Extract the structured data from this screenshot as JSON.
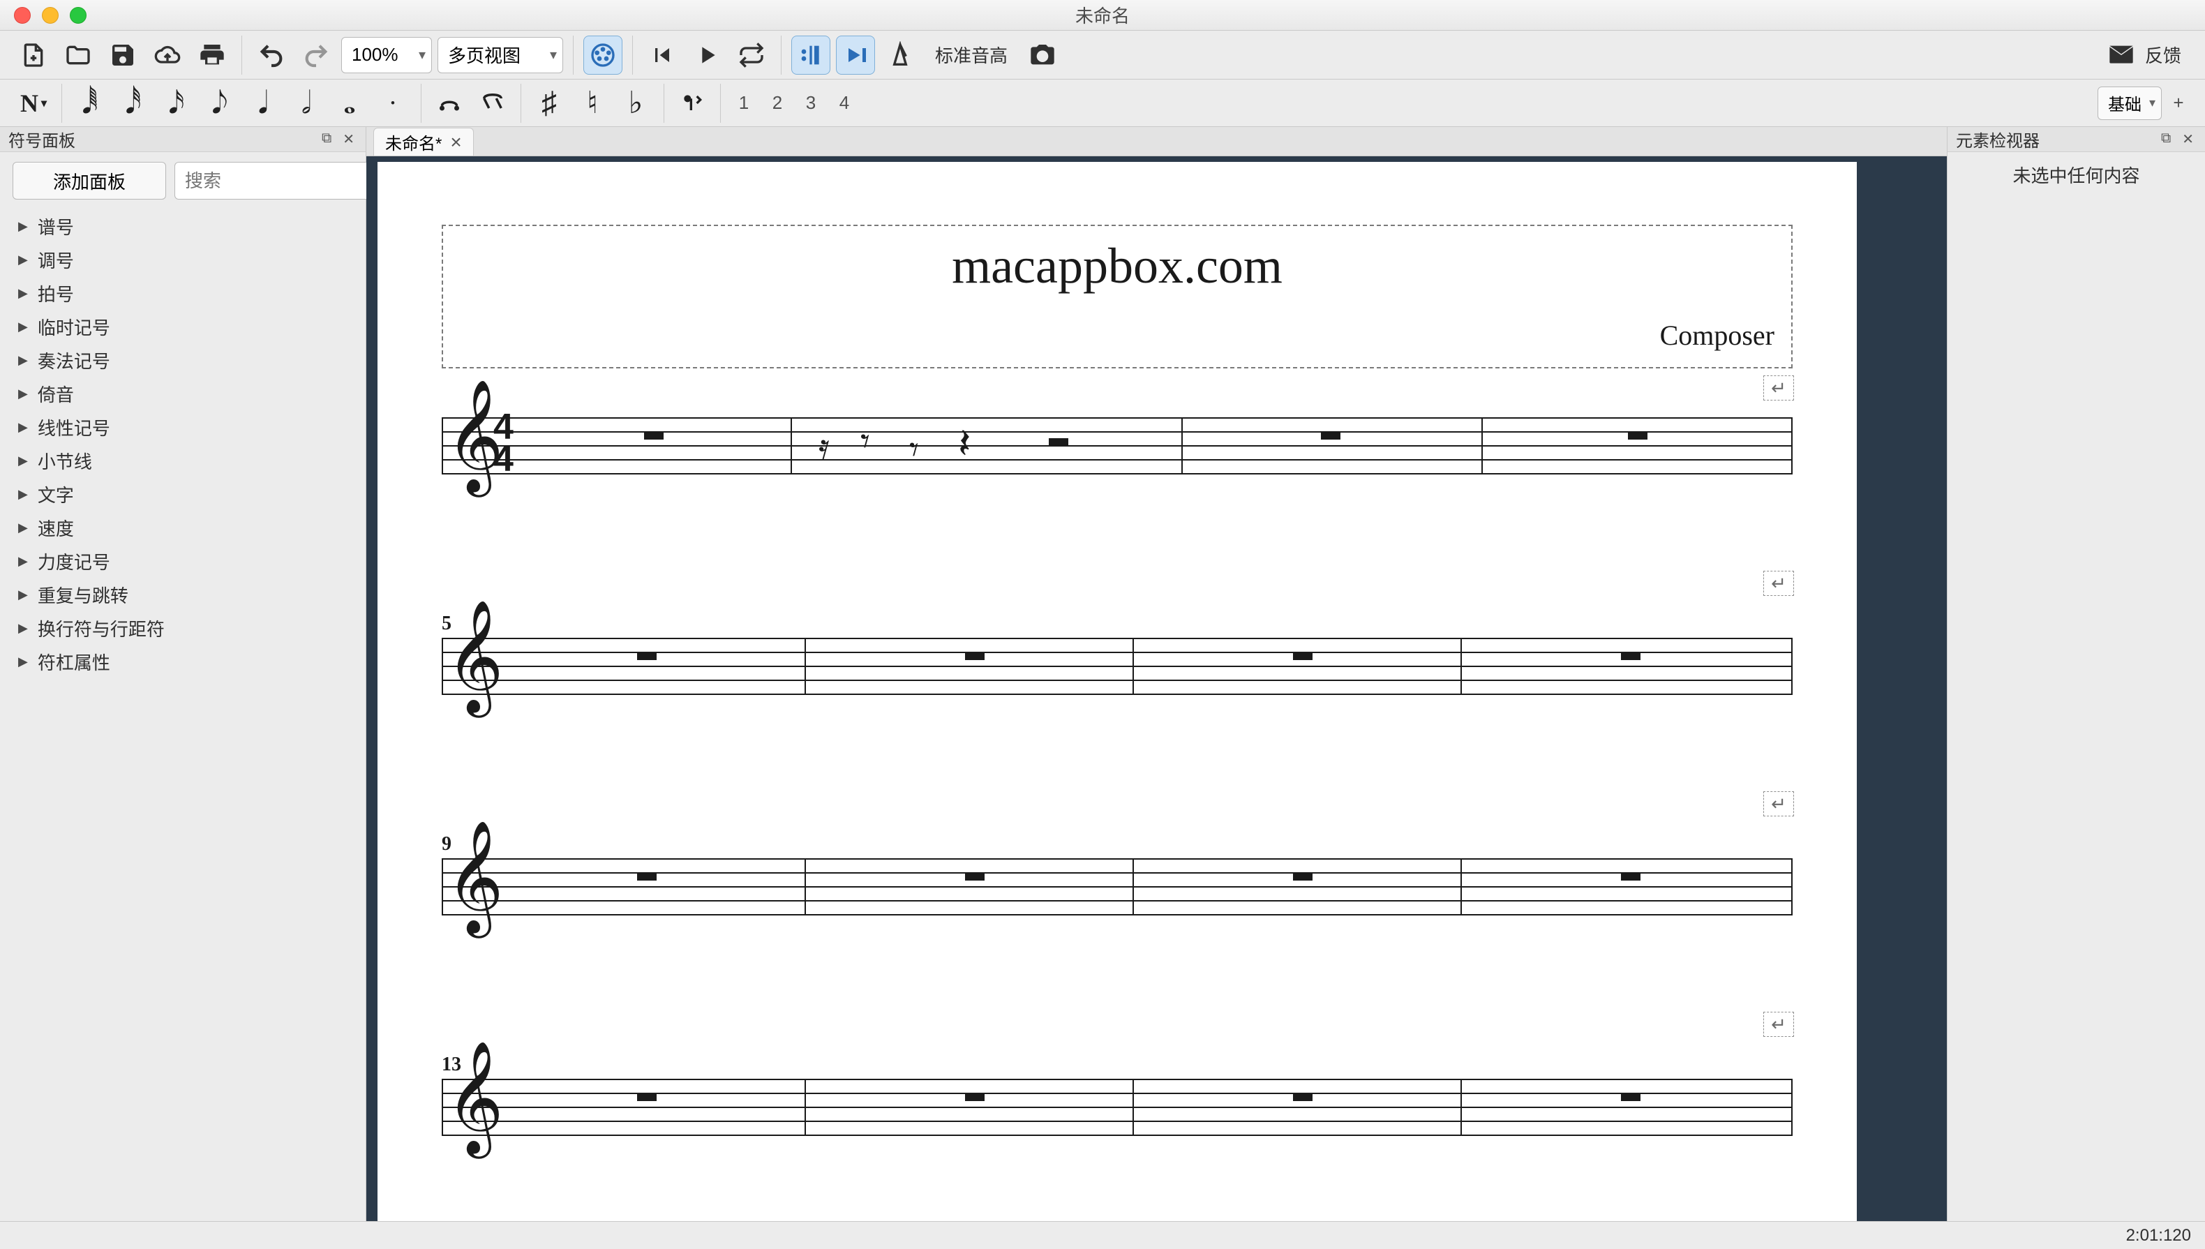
{
  "window": {
    "title": "未命名"
  },
  "toolbar1": {
    "zoom": "100%",
    "view_mode": "多页视图",
    "pitch_label": "标准音高",
    "feedback_label": "反馈"
  },
  "toolbar2": {
    "voices": [
      "1",
      "2",
      "3",
      "4"
    ],
    "workspace": "基础"
  },
  "left_panel": {
    "title": "符号面板",
    "add_label": "添加面板",
    "search_placeholder": "搜索",
    "items": [
      "谱号",
      "调号",
      "拍号",
      "临时记号",
      "奏法记号",
      "倚音",
      "线性记号",
      "小节线",
      "文字",
      "速度",
      "力度记号",
      "重复与跳转",
      "换行符与行距符",
      "符杠属性"
    ]
  },
  "tabs": [
    {
      "label": "未命名*"
    }
  ],
  "score": {
    "title_text": "macappbox.com",
    "composer": "Composer",
    "timesig_top": "4",
    "timesig_bottom": "4",
    "measure_numbers": [
      "5",
      "9",
      "13"
    ]
  },
  "right_panel": {
    "title": "元素检视器",
    "empty_msg": "未选中任何内容"
  },
  "status": {
    "position": "2:01:120"
  }
}
